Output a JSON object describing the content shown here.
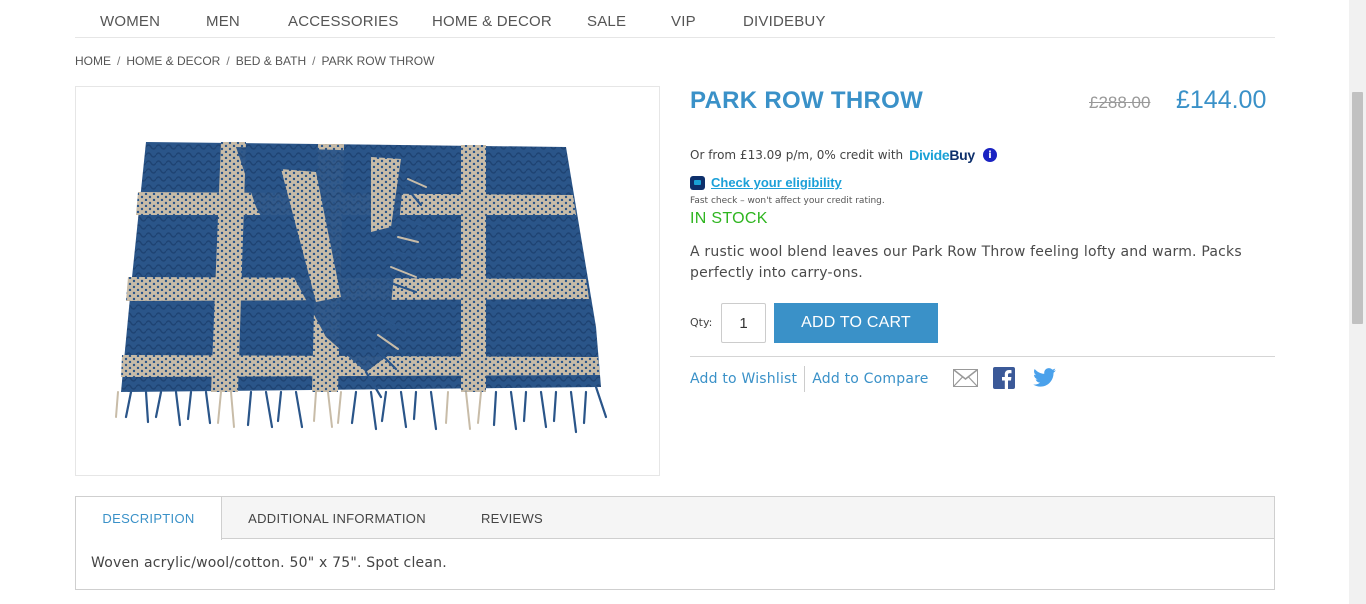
{
  "nav": {
    "items": [
      "WOMEN",
      "MEN",
      "ACCESSORIES",
      "HOME & DECOR",
      "SALE",
      "VIP",
      "DIVIDEBUY"
    ]
  },
  "breadcrumb": {
    "items": [
      "HOME",
      "HOME & DECOR",
      "BED & BATH",
      "PARK ROW THROW"
    ],
    "separator": "/"
  },
  "product": {
    "title": "PARK ROW THROW",
    "old_price": "£288.00",
    "price": "£144.00",
    "credit_text": "Or from £13.09 p/m, 0% credit with",
    "dividebuy_logo_part1": "Divide",
    "dividebuy_logo_part2": "Buy",
    "info_icon_glyph": "i",
    "eligibility_link": "Check your eligibility",
    "eligibility_note": "Fast check – won't affect your credit rating.",
    "stock": "IN STOCK",
    "short_description": "A rustic wool blend leaves our Park Row Throw feeling lofty and warm. Packs perfectly into carry-ons.",
    "qty_label": "Qty:",
    "qty_value": "1",
    "add_to_cart": "ADD TO CART",
    "wishlist": "Add to Wishlist",
    "compare": "Add to Compare",
    "share_icons": [
      "mail-icon",
      "facebook-icon",
      "twitter-icon"
    ]
  },
  "tabs": {
    "items": [
      "DESCRIPTION",
      "ADDITIONAL INFORMATION",
      "REVIEWS"
    ],
    "active": "DESCRIPTION",
    "content": "Woven acrylic/wool/cotton. 50\" x 75\". Spot clean."
  },
  "colors": {
    "accent": "#3a91c8",
    "in_stock": "#2fb520",
    "dividebuy_light": "#19a1d6",
    "dividebuy_dark": "#0d2f6b",
    "throw_blue": "#2a5589",
    "throw_beige": "#c8bca8"
  }
}
